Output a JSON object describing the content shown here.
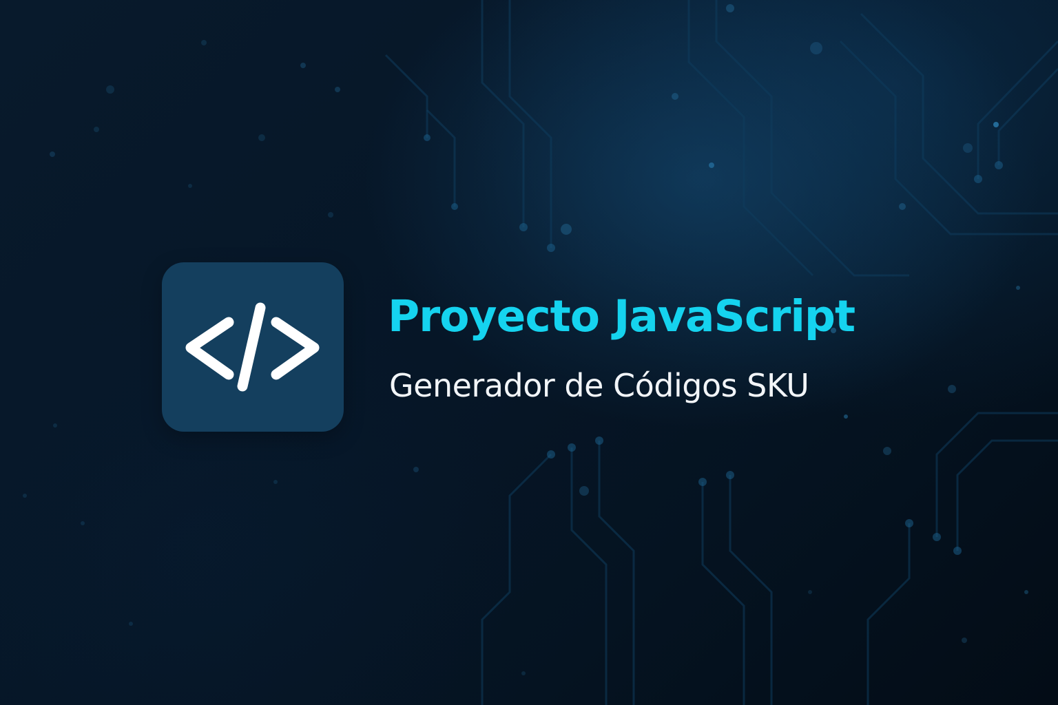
{
  "banner": {
    "title": "Proyecto JavaScript",
    "subtitle": "Generador de Códigos SKU",
    "icon": "code-brackets-icon"
  },
  "colors": {
    "background": "#04111f",
    "accent": "#15d3ef",
    "tile": "#143f5e",
    "subtitle": "#f2f5f8"
  }
}
